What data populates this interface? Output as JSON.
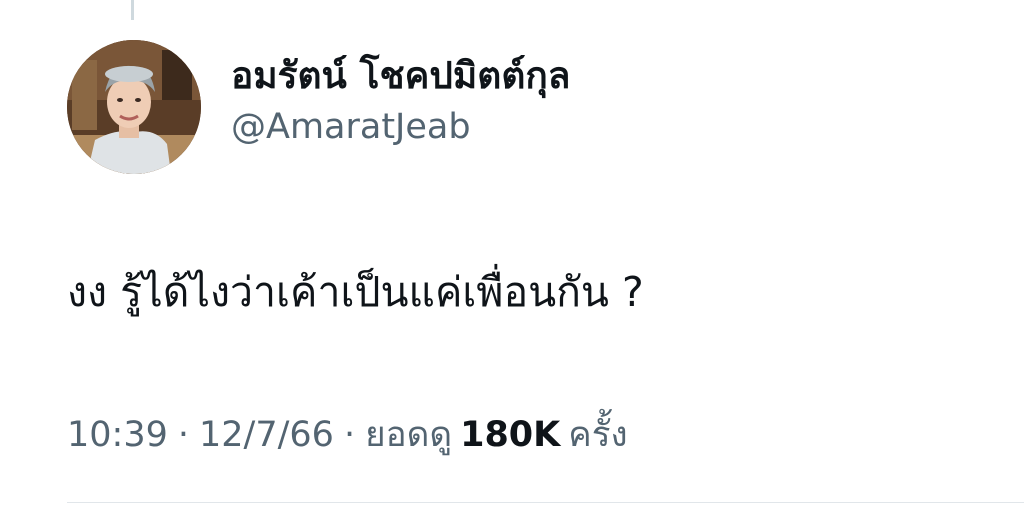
{
  "tweet": {
    "author": {
      "display_name": "อมรัตน์ โชคปมิตต์กุล",
      "handle": "@AmaratJeab"
    },
    "text": "งง รู้ได้ไงว่าเค้าเป็นแค่เพื่อนกัน ?",
    "meta": {
      "time": "10:39",
      "separator": "·",
      "date": "12/7/66",
      "views_label": "ยอดดู",
      "views_count": "180K",
      "views_unit": "ครั้ง"
    }
  },
  "colors": {
    "text_primary": "#0f1419",
    "text_secondary": "#536471",
    "thread_line": "#cfd9de",
    "divider": "#e1e6ea"
  }
}
